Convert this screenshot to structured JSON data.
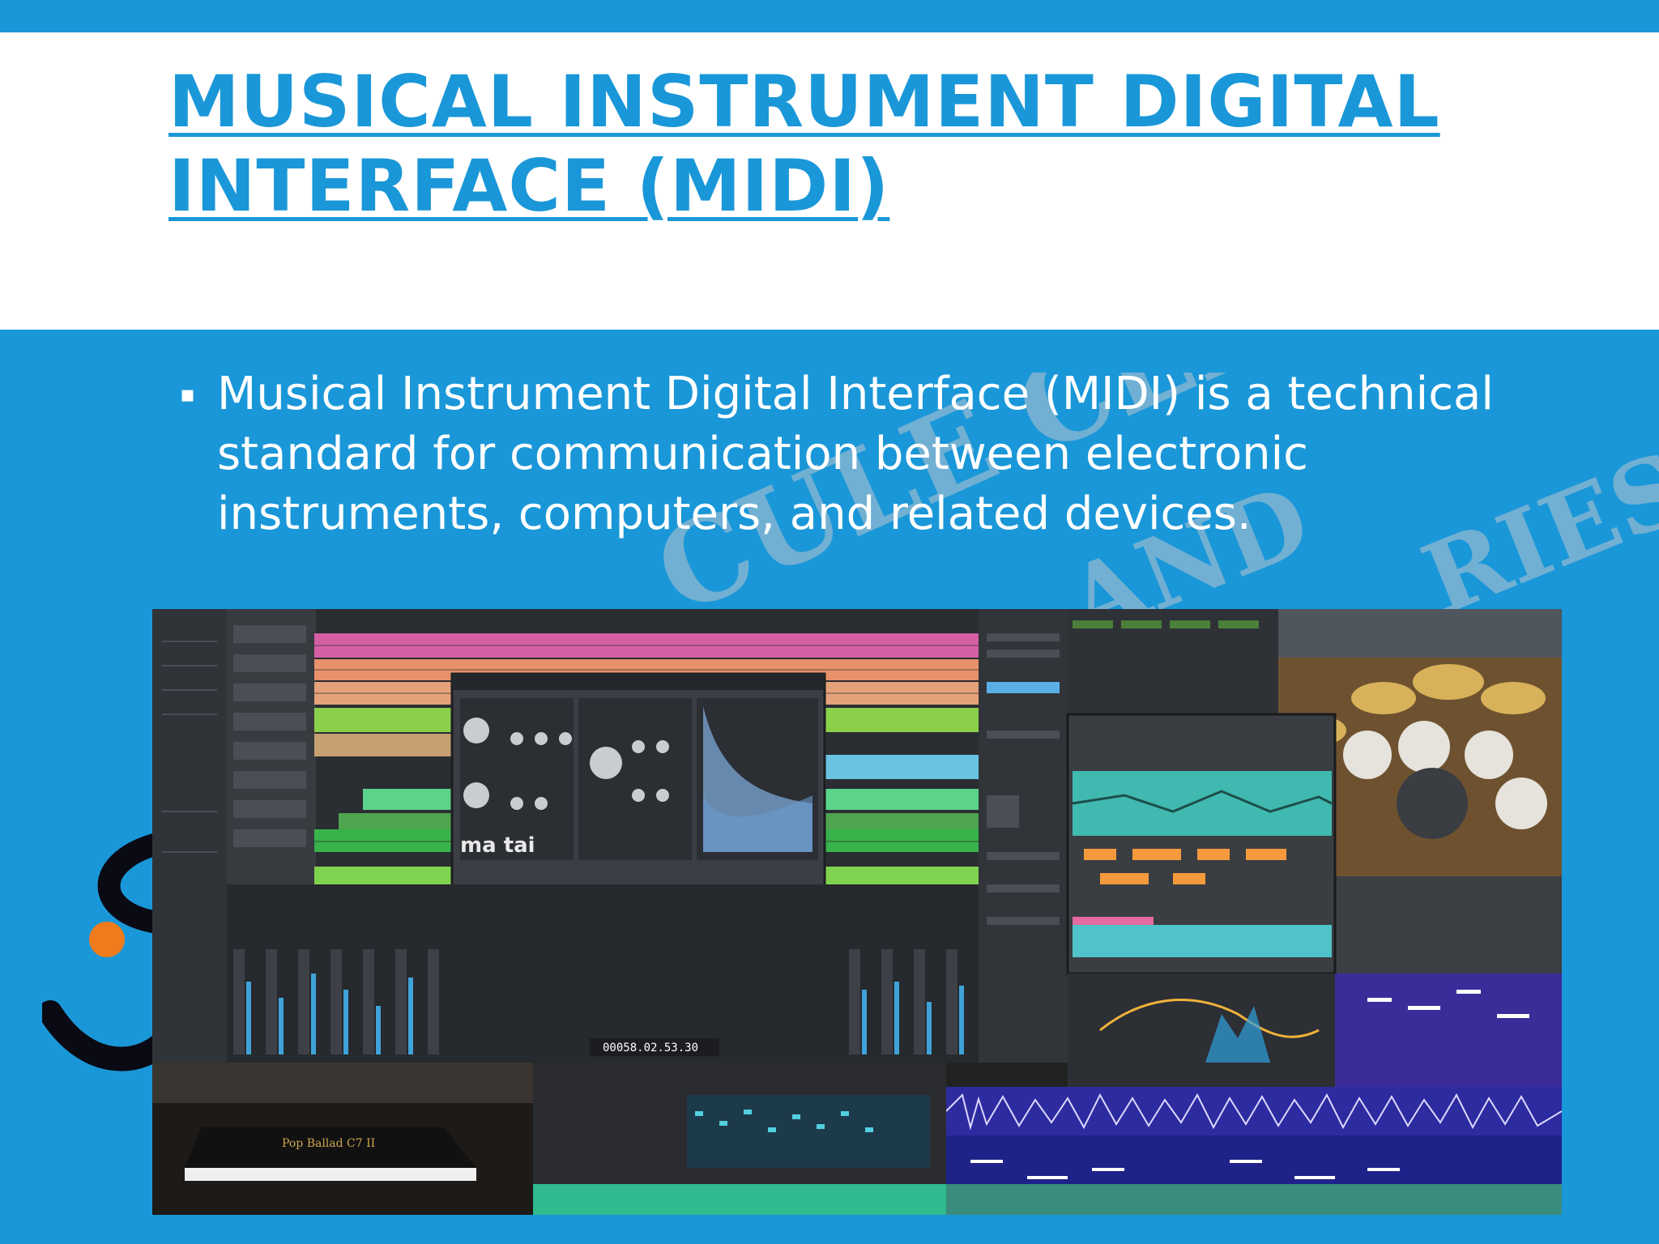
{
  "slide": {
    "title": "MUSICAL INSTRUMENT DIGITAL INTERFACE (MIDI)",
    "bullets": [
      {
        "text": "Musical Instrument Digital Interface (MIDI) is a technical standard for communication between electronic instruments, computers, and related devices."
      }
    ],
    "bullet_glyph": "▪"
  },
  "watermark": {
    "line1": "CULE CENTER",
    "line2": "AND",
    "line3": "RIES"
  },
  "collage": {
    "synth_logo": "ma tai",
    "piano_plate": "Pop Ballad C7 II",
    "transport_counter": "00058.02.53.30"
  },
  "colors": {
    "accent": "#1a97d8",
    "title_band": "#ffffff",
    "text_on_accent": "#ffffff"
  }
}
